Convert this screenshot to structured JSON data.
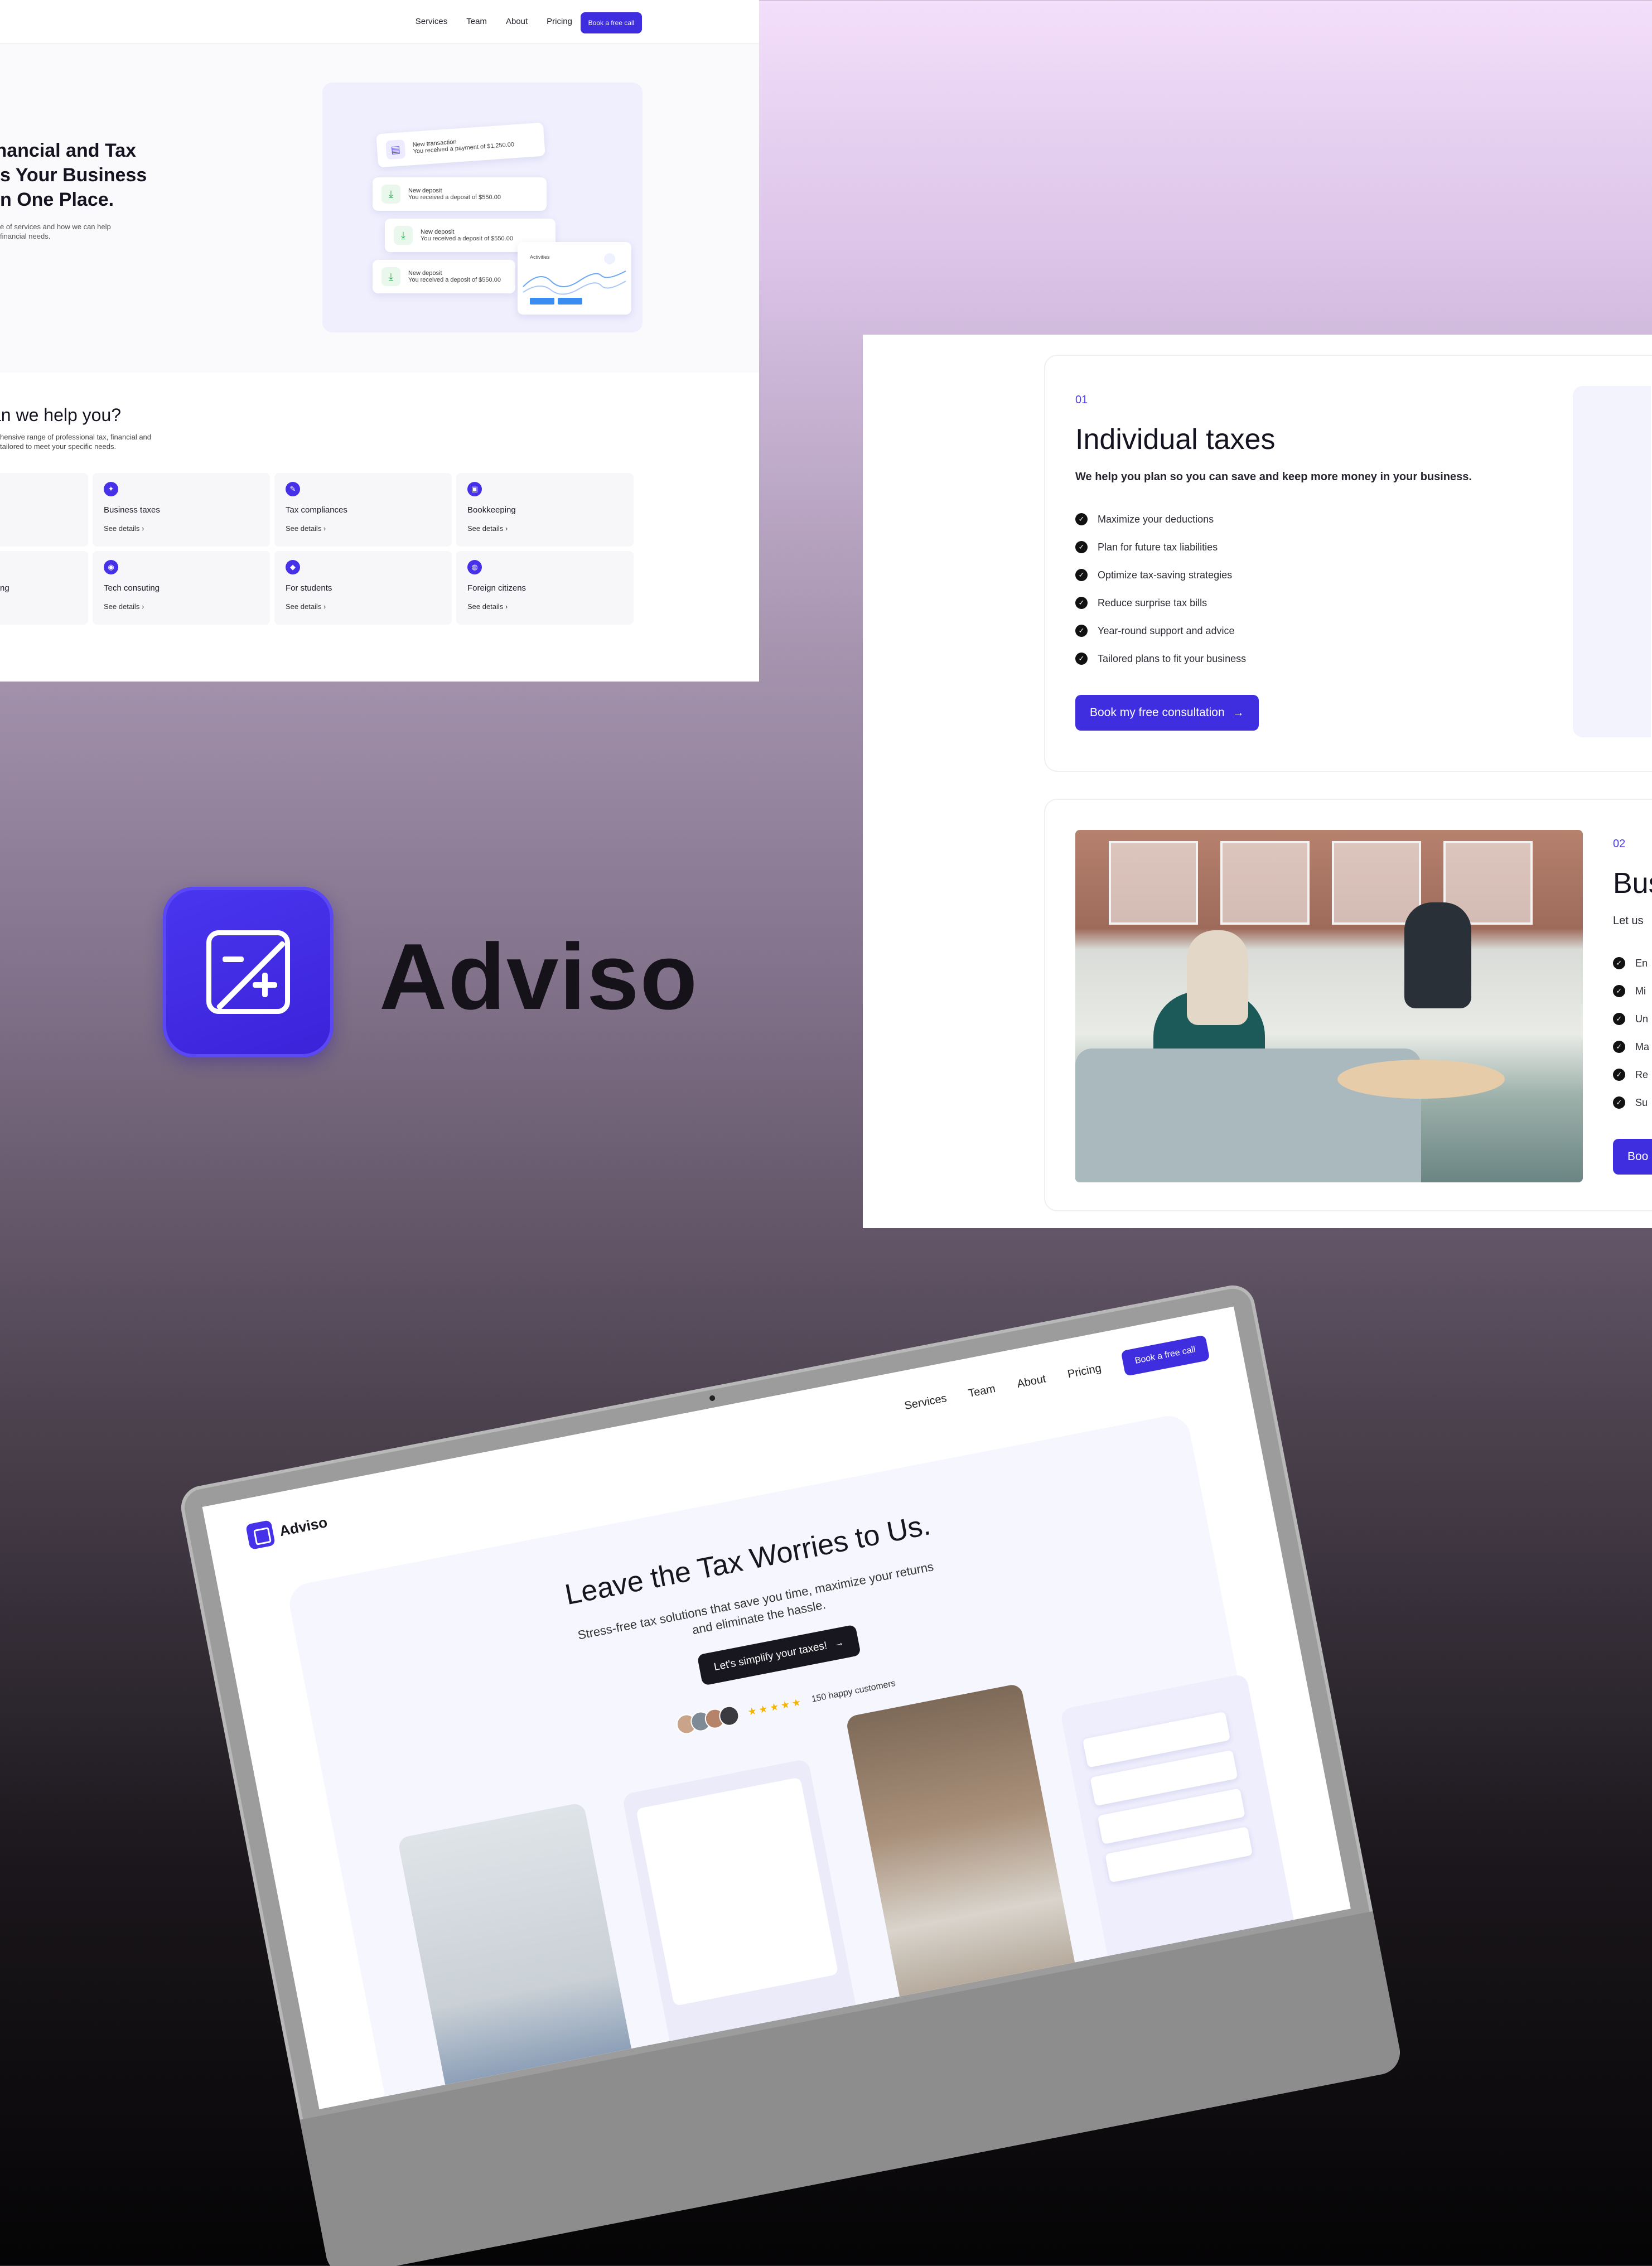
{
  "panel1": {
    "nav": {
      "links": [
        "Services",
        "Team",
        "About",
        "Pricing"
      ],
      "cta_label": "Book a free call"
    },
    "hero": {
      "title": "inancial and Tax\ns Your Business\nn One Place.",
      "subtitle": "e of services and how we can help\nfinancial needs."
    },
    "transactions": [
      {
        "title": "New transaction",
        "detail": "You received a payment of $1,250.00"
      },
      {
        "title": "New deposit",
        "detail": "You received a deposit of $550.00"
      },
      {
        "title": "New deposit",
        "detail": "You received a deposit of $550.00"
      },
      {
        "title": "New deposit",
        "detail": "You received a deposit of $550.00"
      }
    ],
    "chart_widget_label": "Activities",
    "help": {
      "title": "an we help you?",
      "subtitle": "hensive range of professional tax, financial and\ntailored to meet your specific needs."
    },
    "services": [
      {
        "name": "",
        "details": ""
      },
      {
        "name": "Business taxes",
        "details": "See details"
      },
      {
        "name": "Tax compliances",
        "details": "See details"
      },
      {
        "name": "Bookkeeping",
        "details": "See details"
      },
      {
        "name": "ng",
        "details": ""
      },
      {
        "name": "Tech consuting",
        "details": "See details"
      },
      {
        "name": "For students",
        "details": "See details"
      },
      {
        "name": "Foreign citizens",
        "details": "See details"
      }
    ]
  },
  "panel2": {
    "card1": {
      "number": "01",
      "title": "Individual taxes",
      "subtitle": "We help you plan so you can save and keep more money in your business.",
      "checks": [
        "Maximize your deductions",
        "Plan for future tax liabilities",
        "Optimize tax-saving strategies",
        "Reduce surprise tax bills",
        "Year-round support and advice",
        "Tailored plans to fit your business"
      ],
      "button_label": "Book my free consultation"
    },
    "card2": {
      "number": "02",
      "title": "Bus",
      "subtitle": "Let us",
      "checks": [
        "En",
        "Mi",
        "Un",
        "Ma",
        "Re",
        "Su"
      ],
      "button_label": "Boo"
    }
  },
  "brand": {
    "name": "Adviso",
    "accent": "#3f2de0"
  },
  "monitor": {
    "logo_text": "Adviso",
    "nav": {
      "links": [
        "Services",
        "Team",
        "About",
        "Pricing"
      ],
      "cta_label": "Book a free call"
    },
    "hero": {
      "title": "Leave the Tax Worries to Us.",
      "subtitle": "Stress-free tax solutions that save you time, maximize your returns\nand eliminate the hassle.",
      "cta_label": "Let's simplify your taxes!",
      "stars": "★★★★★",
      "customers": "150 happy customers"
    }
  }
}
